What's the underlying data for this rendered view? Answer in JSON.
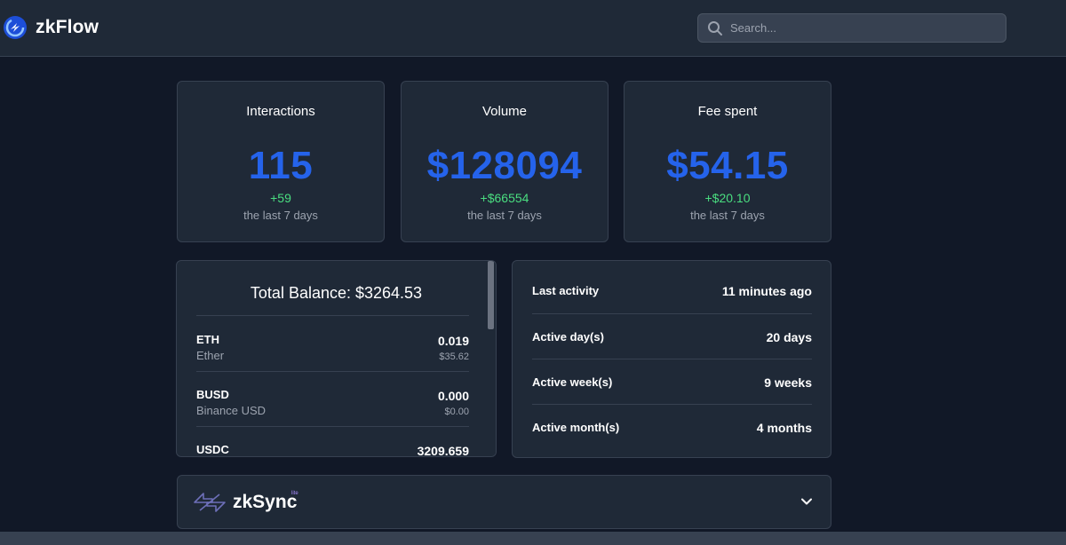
{
  "header": {
    "brand": "zkFlow",
    "search_placeholder": "Search..."
  },
  "stats": [
    {
      "title": "Interactions",
      "value": "115",
      "delta": "+59",
      "period": "the last 7 days"
    },
    {
      "title": "Volume",
      "value": "$128094",
      "delta": "+$66554",
      "period": "the last 7 days"
    },
    {
      "title": "Fee spent",
      "value": "$54.15",
      "delta": "+$20.10",
      "period": "the last 7 days"
    }
  ],
  "balance": {
    "title": "Total Balance: $3264.53",
    "tokens": [
      {
        "symbol": "ETH",
        "name": "Ether",
        "amount": "0.019",
        "usd": "$35.62"
      },
      {
        "symbol": "BUSD",
        "name": "Binance USD",
        "amount": "0.000",
        "usd": "$0.00"
      },
      {
        "symbol": "USDC",
        "name": "",
        "amount": "3209.659",
        "usd": ""
      }
    ]
  },
  "activity": [
    {
      "label": "Last activity",
      "value": "11 minutes ago"
    },
    {
      "label": "Active day(s)",
      "value": "20 days"
    },
    {
      "label": "Active week(s)",
      "value": "9 weeks"
    },
    {
      "label": "Active month(s)",
      "value": "4 months"
    }
  ],
  "zksync": {
    "name": "zkSync",
    "sup": "lite"
  },
  "colors": {
    "background": "#111827",
    "card": "#1f2937",
    "accent": "#2563eb",
    "positive": "#4ade80"
  },
  "icons": {
    "brand": "zkflow-logo-icon",
    "search": "search-icon",
    "zksync": "zksync-logo-icon",
    "expand": "chevron-down-icon"
  }
}
